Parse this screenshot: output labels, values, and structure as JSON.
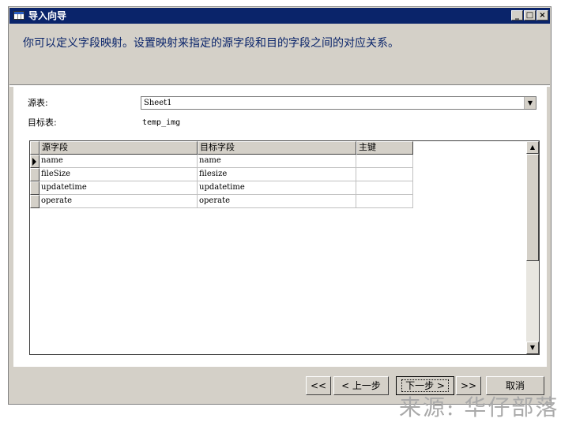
{
  "window": {
    "title": "导入向导",
    "controls": {
      "minimize": "_",
      "maximize": "□",
      "close": "×"
    }
  },
  "header": {
    "description": "你可以定义字段映射。设置映射来指定的源字段和目的字段之间的对应关系。"
  },
  "form": {
    "source_label": "源表:",
    "source_value": "Sheet1",
    "target_label": "目标表:",
    "target_value": "temp_img"
  },
  "grid": {
    "columns": [
      "源字段",
      "目标字段",
      "主键"
    ],
    "rows": [
      {
        "source": "name",
        "target": "name",
        "key": ""
      },
      {
        "source": "fileSize",
        "target": "filesize",
        "key": ""
      },
      {
        "source": "updatetime",
        "target": "updatetime",
        "key": ""
      },
      {
        "source": "operate",
        "target": "operate",
        "key": ""
      }
    ]
  },
  "buttons": {
    "first": "<<",
    "prev": "< 上一步",
    "next": "下一步 >",
    "last": ">>",
    "cancel": "取消"
  },
  "icons": {
    "app": "table-icon",
    "combo_arrow": "chevron-down-icon",
    "row_pointer": "row-pointer-icon",
    "scroll_up": "scroll-up-icon",
    "scroll_down": "scroll-down-icon"
  },
  "colors": {
    "titlebar": "#0a246a",
    "description": "#0a246a",
    "face": "#d4d0c8"
  },
  "watermark": "来源: 华仔部落"
}
